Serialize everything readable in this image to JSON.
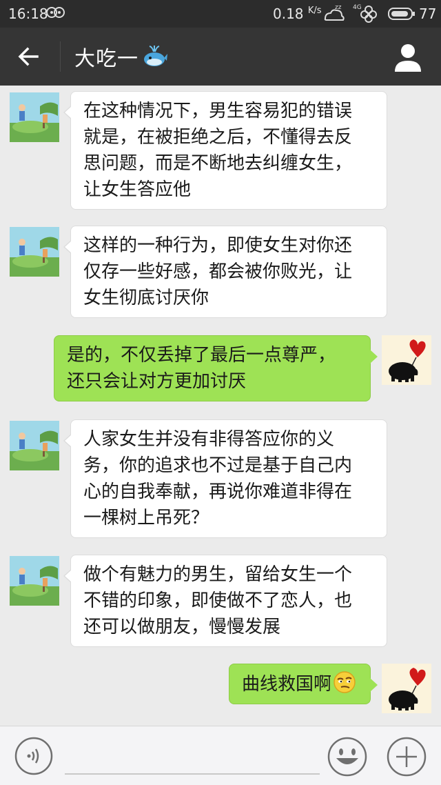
{
  "status_bar": {
    "time": "16:18",
    "speed": "0.18",
    "speed_unit": "K/s",
    "network": "4G",
    "battery": "77"
  },
  "header": {
    "title": "大吃一",
    "title_icon": "whale-emoji-icon",
    "back_icon": "back-arrow-icon",
    "profile_icon": "user-icon"
  },
  "messages": [
    {
      "side": "in",
      "lines": [
        "在这种情况下，男生容易犯的错误",
        "就是，在被拒绝之后，不懂得去反",
        "思问题，而是不断地去纠缠女生，",
        "让女生答应他"
      ]
    },
    {
      "side": "in",
      "lines": [
        "这样的一种行为，即使女生对你还",
        "仅存一些好感，都会被你败光，让",
        "女生彻底讨厌你"
      ]
    },
    {
      "side": "out",
      "lines": [
        "是的，不仅丢掉了最后一点尊严，",
        "还只会让对方更加讨厌"
      ]
    },
    {
      "side": "in",
      "lines": [
        "人家女生并没有非得答应你的义",
        "务，你的追求也不过是基于自己内",
        "心的自我奉献，再说你难道非得在",
        "一棵树上吊死？"
      ]
    },
    {
      "side": "in",
      "lines": [
        "做个有魅力的男生，留给女生一个",
        "不错的印象，即使做不了恋人，也",
        "还可以做朋友，慢慢发展"
      ]
    },
    {
      "side": "out",
      "lines": [
        "曲线救国啊"
      ],
      "emoji": "smug-face-emoji-icon"
    }
  ],
  "input_bar": {
    "voice_icon": "voice-icon",
    "text_value": "",
    "emoji_icon": "smiley-icon",
    "more_icon": "plus-icon"
  },
  "colors": {
    "status_bg": "#2c2c2c",
    "header_bg": "#353535",
    "chat_bg": "#ebebeb",
    "incoming_bubble": "#ffffff",
    "outgoing_bubble": "#9ee255"
  }
}
